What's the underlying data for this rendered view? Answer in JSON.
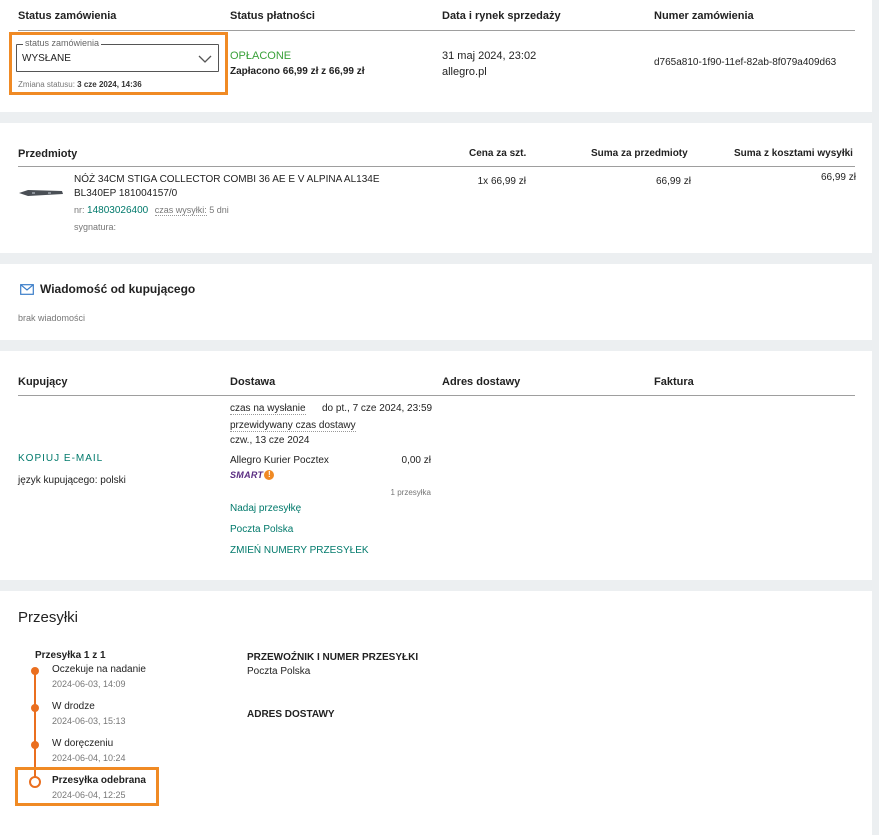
{
  "order_status": {
    "col_headers": [
      "Status zamówienia",
      "Status płatności",
      "Data i rynek sprzedaży",
      "Numer zamówienia"
    ],
    "select_legend": "status zamówienia",
    "select_value": "WYSŁANE",
    "status_change_label": "Zmiana statusu:",
    "status_change_date": "3 cze 2024, 14:36",
    "payment_status": "OPŁACONE",
    "payment_paid": "Zapłacono 66,99 zł z 66,99 zł",
    "sale_date": "31 maj 2024, 23:02",
    "marketplace": "allegro.pl",
    "order_number": "d765a810-1f90-11ef-82ab-8f079a409d63"
  },
  "items": {
    "col_headers": [
      "Przedmioty",
      "Cena za szt.",
      "Suma za przedmioty",
      "Suma z kosztami wysyłki"
    ],
    "rows": [
      {
        "name_line1": "NÓŻ 34CM STIGA COLLECTOR COMBI 36 AE E V ALPINA AL134E",
        "name_line2": "BL340EP 181004157/0",
        "nr_label": "nr:",
        "nr_value": "14803026400",
        "shipping_time_label": "czas wysyłki:",
        "shipping_time_value": "5 dni",
        "signature_label": "sygnatura:",
        "unit_price": "1x 66,99 zł",
        "items_total": "66,99 zł",
        "total_with_shipping": "66,99 zł"
      }
    ]
  },
  "buyer_message": {
    "title": "Wiadomość od kupującego",
    "body": "brak wiadomości"
  },
  "buyer": {
    "col_headers": [
      "Kupujący",
      "Dostawa",
      "Adres dostawy",
      "Faktura"
    ],
    "copy_email": "KOPIUJ E-MAIL",
    "language": "język kupującego: polski",
    "send_time_label": "czas na wysłanie",
    "send_time_value": "do pt., 7 cze 2024, 23:59",
    "expected_delivery_label": "przewidywany czas dostawy",
    "expected_delivery_value": "czw., 13 cze 2024",
    "carrier": "Allegro Kurier Pocztex",
    "carrier_price": "0,00 zł",
    "smart_label": "SMART",
    "parcels_count": "1 przesyłka",
    "send_parcel_link": "Nadaj przesyłkę",
    "postal_link": "Poczta Polska",
    "change_numbers_link": "ZMIEŃ NUMERY PRZESYŁEK"
  },
  "shipments": {
    "title": "Przesyłki",
    "subtitle": "Przesyłka 1 z 1",
    "timeline": [
      {
        "label": "Oczekuje na nadanie",
        "date": "2024-06-03, 14:09"
      },
      {
        "label": "W drodze",
        "date": "2024-06-03, 15:13"
      },
      {
        "label": "W doręczeniu",
        "date": "2024-06-04, 10:24"
      },
      {
        "label": "Przesyłka odebrana",
        "date": "2024-06-04, 12:25"
      }
    ],
    "carrier_header": "PRZEWOŹNIK I NUMER PRZESYŁKI",
    "carrier_name": "Poczta Polska",
    "address_header": "ADRES DOSTAWY"
  },
  "colors": {
    "accent": "#f08a24",
    "teal": "#00796b",
    "paid_green": "#3aa13a",
    "timeline_orange": "#ea6f1f"
  },
  "icons": [
    "chevron-down-icon",
    "envelope-icon",
    "knife-thumbnail",
    "smart-badge-icon"
  ]
}
